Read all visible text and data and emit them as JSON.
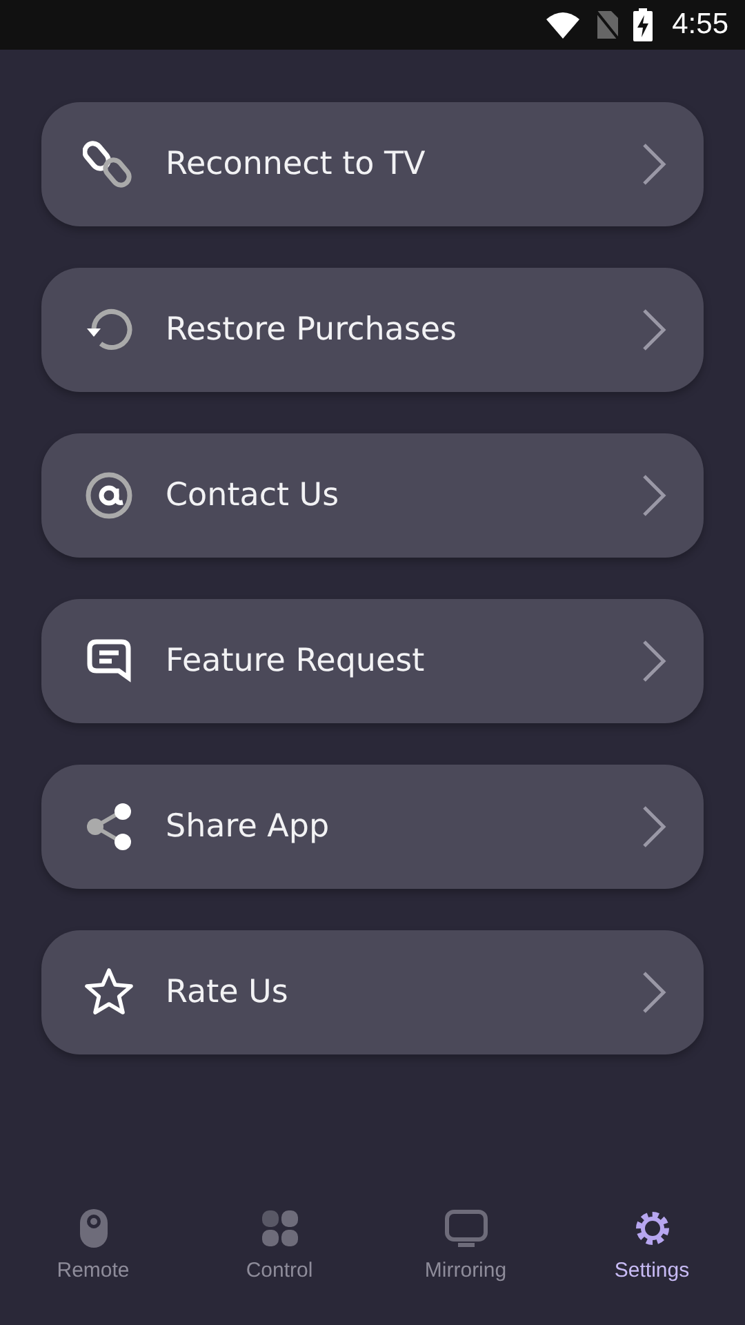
{
  "status_bar": {
    "time": "4:55"
  },
  "menu_items": [
    {
      "kind": "link",
      "label": "Reconnect to TV"
    },
    {
      "kind": "restore",
      "label": "Restore Purchases"
    },
    {
      "kind": "at",
      "label": "Contact Us"
    },
    {
      "kind": "chat",
      "label": "Feature Request"
    },
    {
      "kind": "share",
      "label": "Share App"
    },
    {
      "kind": "star",
      "label": "Rate Us"
    }
  ],
  "bottom_nav": [
    {
      "kind": "remote",
      "label": "Remote",
      "selected": false
    },
    {
      "kind": "grid",
      "label": "Control",
      "selected": false
    },
    {
      "kind": "mirror",
      "label": "Mirroring",
      "selected": false
    },
    {
      "kind": "gear",
      "label": "Settings",
      "selected": true
    }
  ]
}
